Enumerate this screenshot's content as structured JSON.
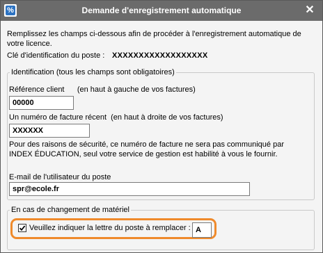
{
  "window": {
    "title": "Demande d'enregistrement automatique",
    "close_glyph": "✕"
  },
  "intro_text": "Remplissez les champs ci-dessous afin de procéder à l'enregistrement automatique de votre licence.",
  "cle": {
    "label": "Clé d'identification du poste :",
    "value": "XXXXXXXXXXXXXXXXXX"
  },
  "identification": {
    "legend": "Identification (tous les champs sont obligatoires)",
    "reference": {
      "label": "Référence client      (en haut à gauche de vos factures)",
      "value": "00000"
    },
    "facture": {
      "label": "Un numéro de facture récent  (en haut à droite de vos factures)",
      "value": "XXXXXX"
    },
    "security_text": "Pour des raisons de sécurité, ce numéro de facture ne sera pas communiqué par INDEX ÉDUCATION, seul votre service de gestion est habilité à vous le fournir.",
    "email": {
      "label": "E-mail de l'utilisateur du poste",
      "value": "spr@ecole.fr"
    }
  },
  "materiel": {
    "legend": "En cas de changement de matériel",
    "checkbox_label": "Veuillez indiquer la lettre du poste à remplacer :",
    "checked": true,
    "letter": "A"
  },
  "colors": {
    "titlebar": "#6b6b6b",
    "highlight": "#ef8a2b",
    "app_icon": "#2d73c2"
  },
  "icons": [
    "app-icon",
    "close-icon",
    "checkmark-icon"
  ]
}
